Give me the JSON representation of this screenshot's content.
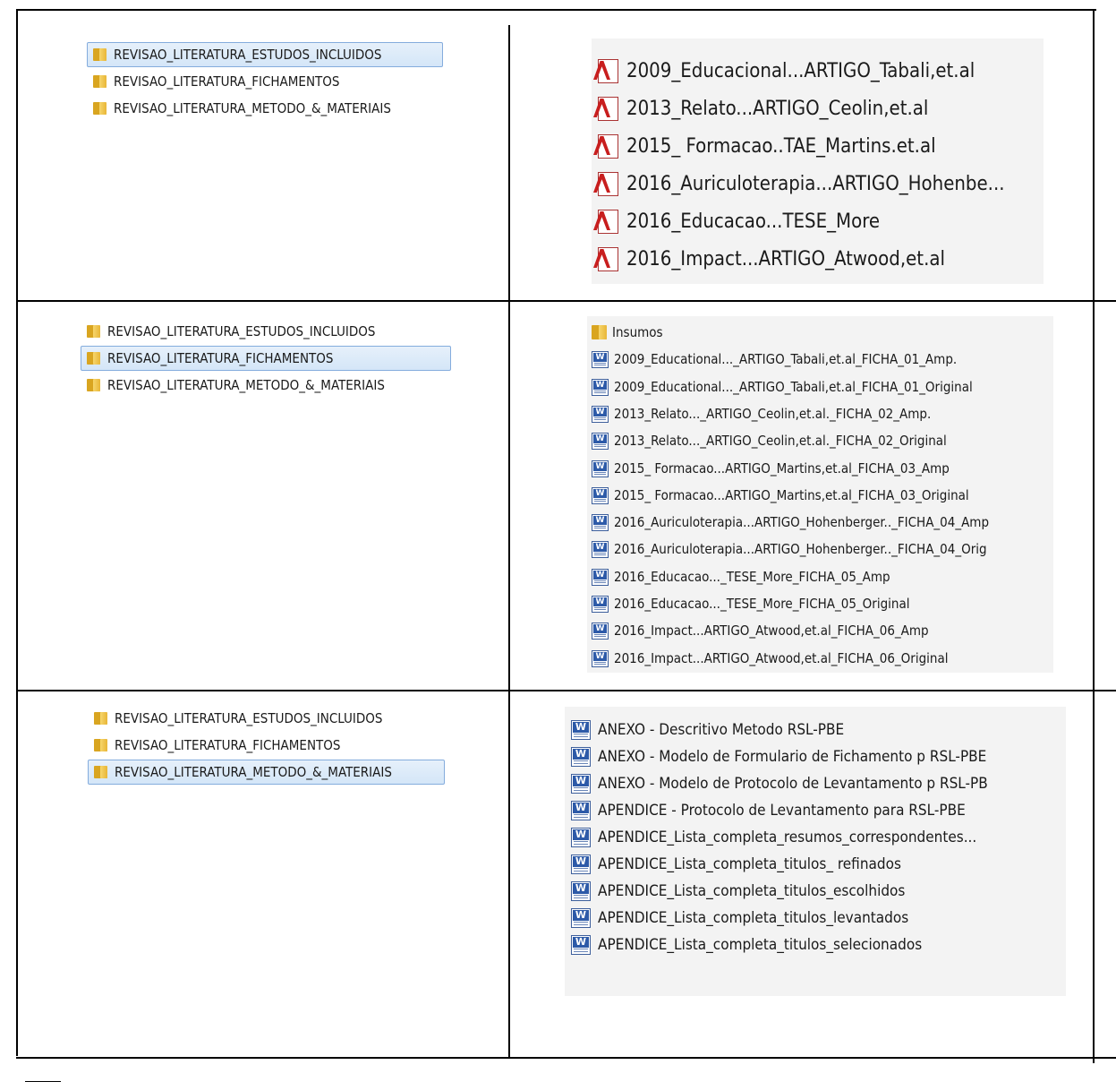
{
  "panels": [
    {
      "folders": [
        {
          "label": "REVISAO_LITERATURA_ESTUDOS_INCLUIDOS",
          "selected": true
        },
        {
          "label": "REVISAO_LITERATURA_FICHAMENTOS",
          "selected": false
        },
        {
          "label": "REVISAO_LITERATURA_METODO_&_MATERIAIS",
          "selected": false
        }
      ],
      "files": [
        {
          "icon": "pdf-icon",
          "label": "2009_Educacional...ARTIGO_Tabali,et.al"
        },
        {
          "icon": "pdf-icon",
          "label": "2013_Relato...ARTIGO_Ceolin,et.al"
        },
        {
          "icon": "pdf-icon",
          "label": "2015_ Formacao..TAE_Martins.et.al"
        },
        {
          "icon": "pdf-icon",
          "label": "2016_Auriculoterapia...ARTIGO_Hohenbe..."
        },
        {
          "icon": "pdf-icon",
          "label": "2016_Educacao...TESE_More"
        },
        {
          "icon": "pdf-icon",
          "label": "2016_Impact...ARTIGO_Atwood,et.al"
        }
      ]
    },
    {
      "folders": [
        {
          "label": "REVISAO_LITERATURA_ESTUDOS_INCLUIDOS",
          "selected": false
        },
        {
          "label": "REVISAO_LITERATURA_FICHAMENTOS",
          "selected": true
        },
        {
          "label": "REVISAO_LITERATURA_METODO_&_MATERIAIS",
          "selected": false
        }
      ],
      "files": [
        {
          "icon": "folder-icon",
          "label": "Insumos"
        },
        {
          "icon": "word-doc-icon",
          "label": "2009_Educational..._ARTIGO_Tabali,et.al_FICHA_01_Amp."
        },
        {
          "icon": "word-doc-icon",
          "label": "2009_Educational..._ARTIGO_Tabali,et.al_FICHA_01_Original"
        },
        {
          "icon": "word-doc-icon",
          "label": "2013_Relato..._ARTIGO_Ceolin,et.al._FICHA_02_Amp."
        },
        {
          "icon": "word-doc-icon",
          "label": "2013_Relato..._ARTIGO_Ceolin,et.al._FICHA_02_Original"
        },
        {
          "icon": "word-doc-icon",
          "label": "2015_ Formacao...ARTIGO_Martins,et.al_FICHA_03_Amp"
        },
        {
          "icon": "word-doc-icon",
          "label": "2015_ Formacao...ARTIGO_Martins,et.al_FICHA_03_Original"
        },
        {
          "icon": "word-doc-icon",
          "label": "2016_Auriculoterapia...ARTIGO_Hohenberger.._FICHA_04_Amp"
        },
        {
          "icon": "word-doc-icon",
          "label": "2016_Auriculoterapia...ARTIGO_Hohenberger.._FICHA_04_Orig"
        },
        {
          "icon": "word-doc-icon",
          "label": "2016_Educacao..._TESE_More_FICHA_05_Amp"
        },
        {
          "icon": "word-doc-icon",
          "label": "2016_Educacao..._TESE_More_FICHA_05_Original"
        },
        {
          "icon": "word-doc-icon",
          "label": "2016_Impact...ARTIGO_Atwood,et.al_FICHA_06_Amp"
        },
        {
          "icon": "word-doc-icon",
          "label": "2016_Impact...ARTIGO_Atwood,et.al_FICHA_06_Original"
        }
      ]
    },
    {
      "folders": [
        {
          "label": "REVISAO_LITERATURA_ESTUDOS_INCLUIDOS",
          "selected": false
        },
        {
          "label": "REVISAO_LITERATURA_FICHAMENTOS",
          "selected": false
        },
        {
          "label": "REVISAO_LITERATURA_METODO_&_MATERIAIS",
          "selected": true
        }
      ],
      "files": [
        {
          "icon": "word-doc-icon",
          "label": "ANEXO - Descritivo Metodo RSL-PBE"
        },
        {
          "icon": "word-doc-icon",
          "label": "ANEXO - Modelo de Formulario de Fichamento p RSL-PBE"
        },
        {
          "icon": "word-doc-icon",
          "label": "ANEXO - Modelo de Protocolo de Levantamento p RSL-PB"
        },
        {
          "icon": "word-doc-icon",
          "label": "APENDICE - Protocolo de Levantamento para RSL-PBE"
        },
        {
          "icon": "word-doc-icon",
          "label": "APENDICE_Lista_completa_resumos_correspondentes..."
        },
        {
          "icon": "word-doc-icon",
          "label": "APENDICE_Lista_completa_titulos_ refinados"
        },
        {
          "icon": "word-doc-icon",
          "label": "APENDICE_Lista_completa_titulos_escolhidos"
        },
        {
          "icon": "word-doc-icon",
          "label": "APENDICE_Lista_completa_titulos_levantados"
        },
        {
          "icon": "word-doc-icon",
          "label": "APENDICE_Lista_completa_titulos_selecionados"
        }
      ]
    }
  ]
}
